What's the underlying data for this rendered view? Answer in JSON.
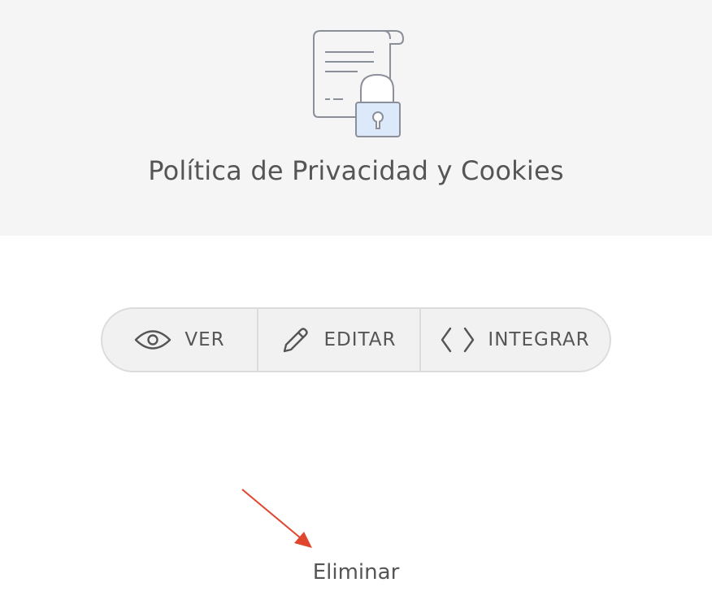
{
  "header": {
    "title": "Política de Privacidad y Cookies",
    "icon": "document-lock-icon"
  },
  "actions": [
    {
      "label": "VER",
      "icon": "eye-icon"
    },
    {
      "label": "EDITAR",
      "icon": "pencil-icon"
    },
    {
      "label": "INTEGRAR",
      "icon": "code-icon"
    }
  ],
  "footer": {
    "delete_label": "Eliminar"
  },
  "colors": {
    "header_bg": "#f5f5f5",
    "text": "#555555",
    "border": "#dcdcdc",
    "button_bg": "#f1f1f1",
    "lock_fill": "#dbe9fb",
    "annotation_arrow": "#e0452d"
  }
}
